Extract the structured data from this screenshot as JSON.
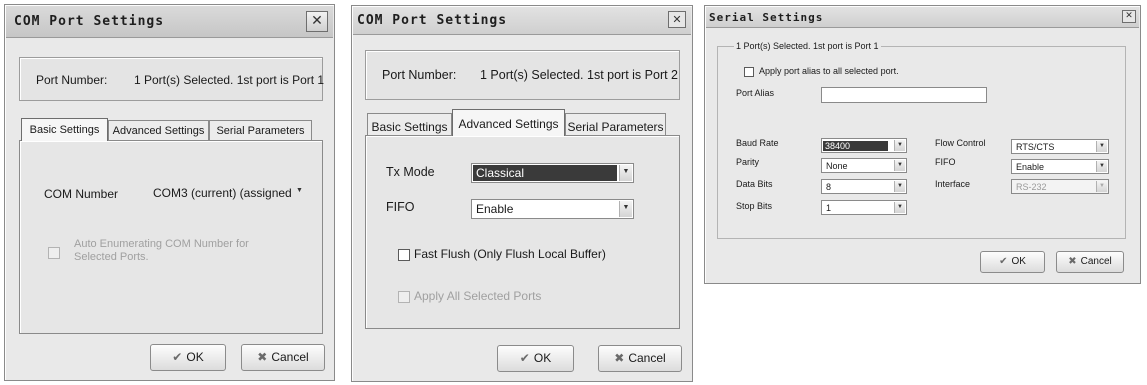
{
  "dialog1": {
    "title": "COM Port Settings",
    "port_number_label": "Port Number:",
    "port_number_value": "1 Port(s) Selected. 1st port is Port 1",
    "tabs": [
      {
        "label": "Basic Settings",
        "active": true
      },
      {
        "label": "Advanced Settings",
        "active": false
      },
      {
        "label": "Serial Parameters",
        "active": false
      }
    ],
    "com_number_label": "COM Number",
    "com_number_value": "COM3 (current) (assigned",
    "auto_enum_label_1": "Auto Enumerating COM Number for",
    "auto_enum_label_2": "Selected Ports.",
    "ok_label": "OK",
    "cancel_label": "Cancel"
  },
  "dialog2": {
    "title": "COM Port Settings",
    "port_number_label": "Port Number:",
    "port_number_value": "1 Port(s) Selected. 1st port is Port 2",
    "tabs": [
      {
        "label": "Basic Settings",
        "active": false
      },
      {
        "label": "Advanced Settings",
        "active": true
      },
      {
        "label": "Serial Parameters",
        "active": false
      }
    ],
    "tx_mode_label": "Tx Mode",
    "tx_mode_value": "Classical",
    "fifo_label": "FIFO",
    "fifo_value": "Enable",
    "fast_flush_label": "Fast Flush (Only Flush Local Buffer)",
    "apply_all_label": "Apply All Selected Ports",
    "ok_label": "OK",
    "cancel_label": "Cancel"
  },
  "dialog3": {
    "title": "Serial Settings",
    "group_label": "1 Port(s) Selected. 1st port is Port 1",
    "apply_alias_label": "Apply port alias to all selected port.",
    "port_alias_label": "Port Alias",
    "port_alias_value": "",
    "baud_rate_label": "Baud Rate",
    "baud_rate_value": "38400",
    "parity_label": "Parity",
    "parity_value": "None",
    "data_bits_label": "Data Bits",
    "data_bits_value": "8",
    "stop_bits_label": "Stop Bits",
    "stop_bits_value": "1",
    "flow_control_label": "Flow Control",
    "flow_control_value": "RTS/CTS",
    "fifo_label": "FIFO",
    "fifo_value": "Enable",
    "interface_label": "Interface",
    "interface_value": "RS-232",
    "ok_label": "OK",
    "cancel_label": "Cancel"
  },
  "icons": {
    "check": "✔",
    "cross": "✖",
    "close": "✕",
    "dropdown": "▼"
  }
}
